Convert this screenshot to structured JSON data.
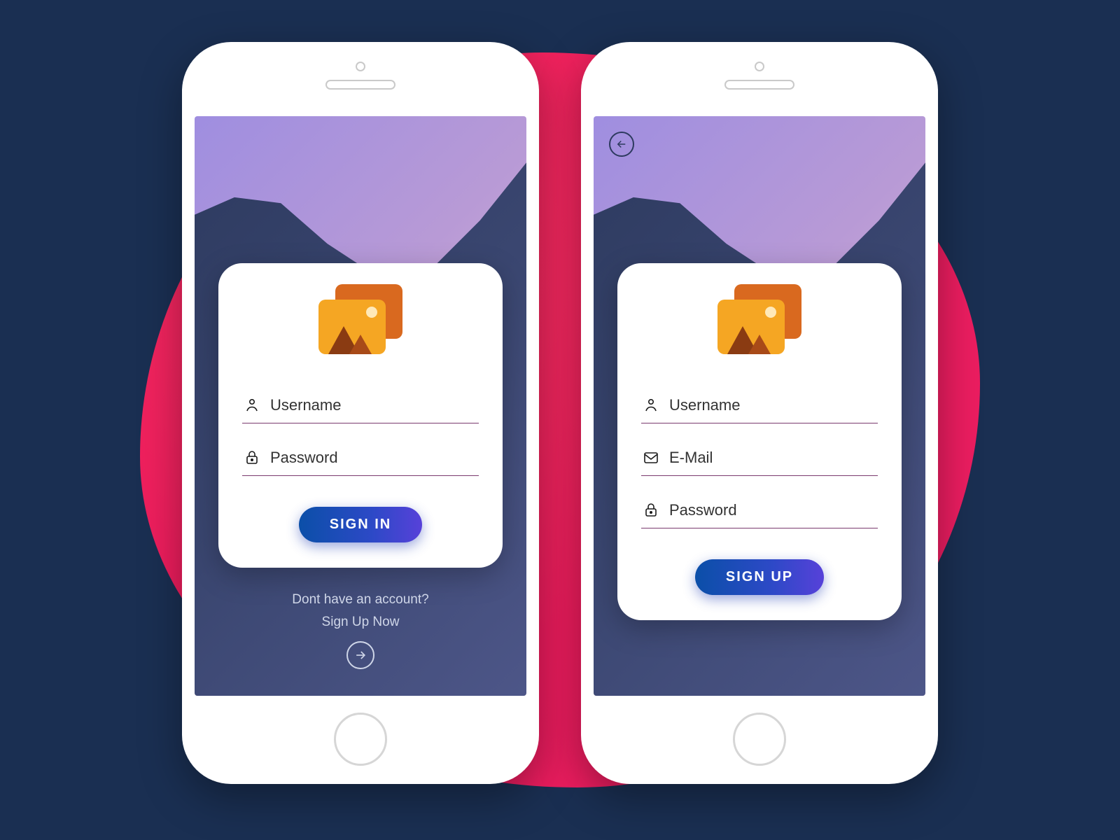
{
  "signin": {
    "username_placeholder": "Username",
    "password_placeholder": "Password",
    "button_label": "SIGN IN",
    "no_account_text": "Dont have an account?",
    "signup_link": "Sign Up Now"
  },
  "signup": {
    "username_placeholder": "Username",
    "email_placeholder": "E-Mail",
    "password_placeholder": "Password",
    "button_label": "SIGN UP"
  },
  "icons": {
    "logo": "image-placeholder-icon",
    "user": "user-icon",
    "lock": "lock-icon",
    "mail": "mail-icon",
    "back": "arrow-left-icon",
    "forward": "arrow-right-icon"
  },
  "colors": {
    "background": "#1a2f52",
    "blob_gradient": [
      "#f52f5e",
      "#e91e63"
    ],
    "screen_gradient": [
      "#9f8ee0",
      "#f2c5c9"
    ],
    "dark_gradient": [
      "#2d3a5f",
      "#4d5688"
    ],
    "button_gradient": [
      "#0b4fa8",
      "#5741d9"
    ],
    "underline": "#7a3a6f"
  }
}
